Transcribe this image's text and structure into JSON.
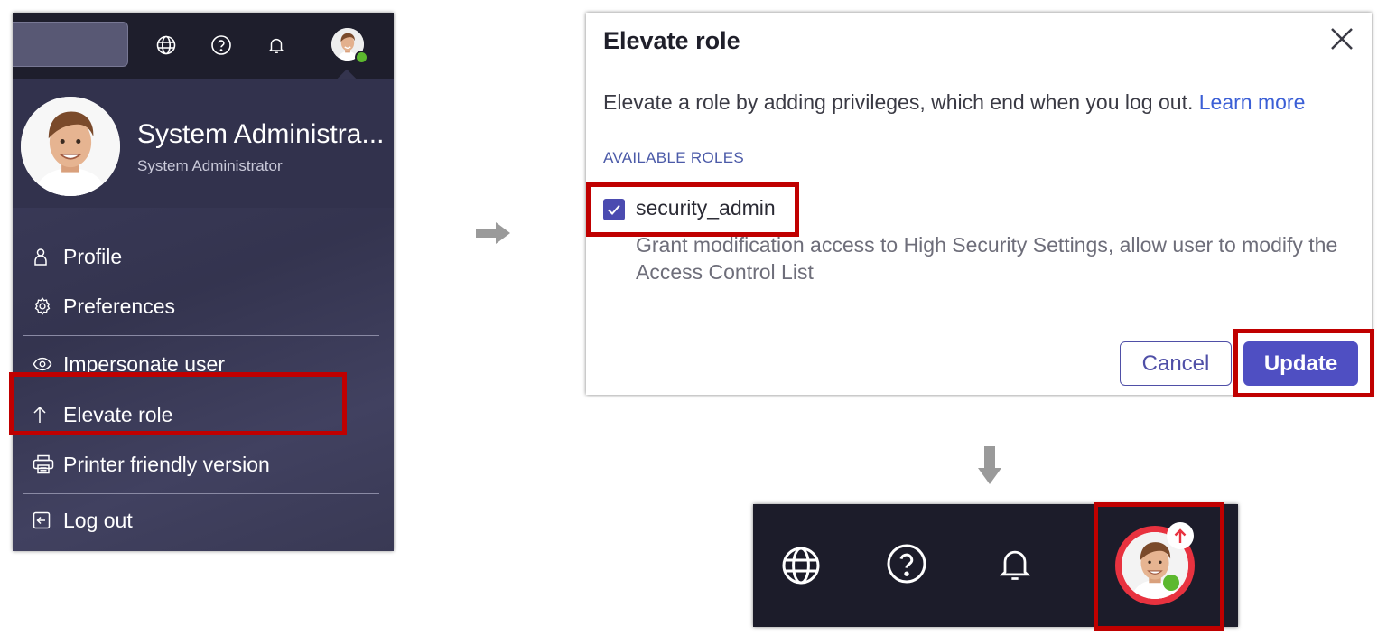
{
  "menu": {
    "user_name": "System Administra...",
    "user_role": "System Administrator",
    "items": [
      {
        "label": "Profile",
        "icon": "user-icon"
      },
      {
        "label": "Preferences",
        "icon": "gear-icon"
      },
      {
        "label": "Impersonate user",
        "icon": "eye-icon"
      },
      {
        "label": "Elevate role",
        "icon": "arrow-up-icon"
      },
      {
        "label": "Printer friendly version",
        "icon": "printer-icon"
      },
      {
        "label": "Log out",
        "icon": "logout-icon"
      }
    ],
    "header_icons": [
      "globe-icon",
      "help-icon",
      "bell-icon",
      "avatar"
    ]
  },
  "modal": {
    "title": "Elevate role",
    "description": "Elevate a role by adding privileges, which end when you log out.",
    "learn_more": "Learn more",
    "roles_label": "AVAILABLE ROLES",
    "role": {
      "name": "security_admin",
      "checked": true,
      "description": "Grant modification access to High Security Settings, allow user to modify the Access Control List"
    },
    "cancel_label": "Cancel",
    "update_label": "Update"
  },
  "bottom_bar": {
    "icons": [
      "globe-icon",
      "help-icon",
      "bell-icon",
      "avatar-elevated"
    ]
  },
  "colors": {
    "highlight": "#c00000",
    "primary": "#4f4fc2",
    "link": "#3b5fd6",
    "online": "#5cb82e",
    "elevated_ring": "#e8323f"
  }
}
